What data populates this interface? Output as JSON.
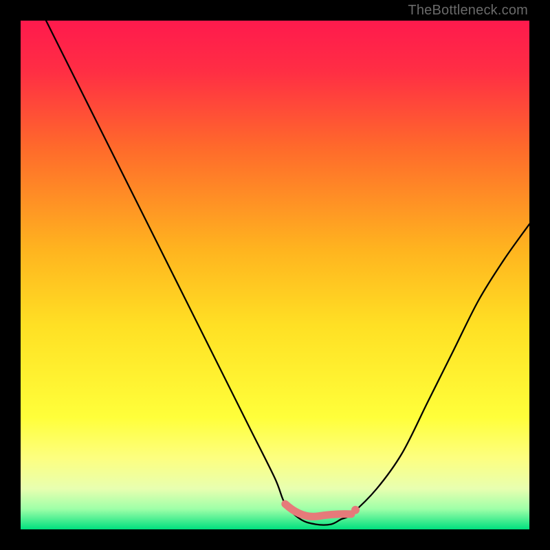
{
  "watermark": "TheBottleneck.com",
  "colors": {
    "frame": "#000000",
    "gradient_stops": [
      {
        "pct": 0,
        "color": "#ff1a4d"
      },
      {
        "pct": 10,
        "color": "#ff2e44"
      },
      {
        "pct": 25,
        "color": "#ff6a2b"
      },
      {
        "pct": 45,
        "color": "#ffb41f"
      },
      {
        "pct": 60,
        "color": "#ffe024"
      },
      {
        "pct": 78,
        "color": "#ffff3a"
      },
      {
        "pct": 86,
        "color": "#fdff80"
      },
      {
        "pct": 92,
        "color": "#e8ffb0"
      },
      {
        "pct": 96,
        "color": "#9effa8"
      },
      {
        "pct": 100,
        "color": "#00e07e"
      }
    ],
    "curve": "#000000",
    "markers": "#e67a7a"
  },
  "chart_data": {
    "type": "line",
    "title": "",
    "xlabel": "",
    "ylabel": "",
    "xlim": [
      0,
      100
    ],
    "ylim": [
      0,
      100
    ],
    "grid": false,
    "legend": false,
    "series": [
      {
        "name": "bottleneck-curve",
        "x": [
          5,
          10,
          15,
          20,
          25,
          30,
          35,
          40,
          45,
          50,
          52,
          55,
          58,
          61,
          63,
          65,
          70,
          75,
          80,
          85,
          90,
          95,
          100
        ],
        "y": [
          100,
          90,
          80,
          70,
          60,
          50,
          40,
          30,
          20,
          10,
          5,
          2,
          1,
          1,
          2,
          3,
          8,
          15,
          25,
          35,
          45,
          53,
          60
        ]
      }
    ],
    "markers": {
      "name": "valley-band",
      "xrange": [
        52,
        65
      ],
      "y_at_range": [
        5,
        3
      ],
      "style": "thick-rounded"
    }
  }
}
